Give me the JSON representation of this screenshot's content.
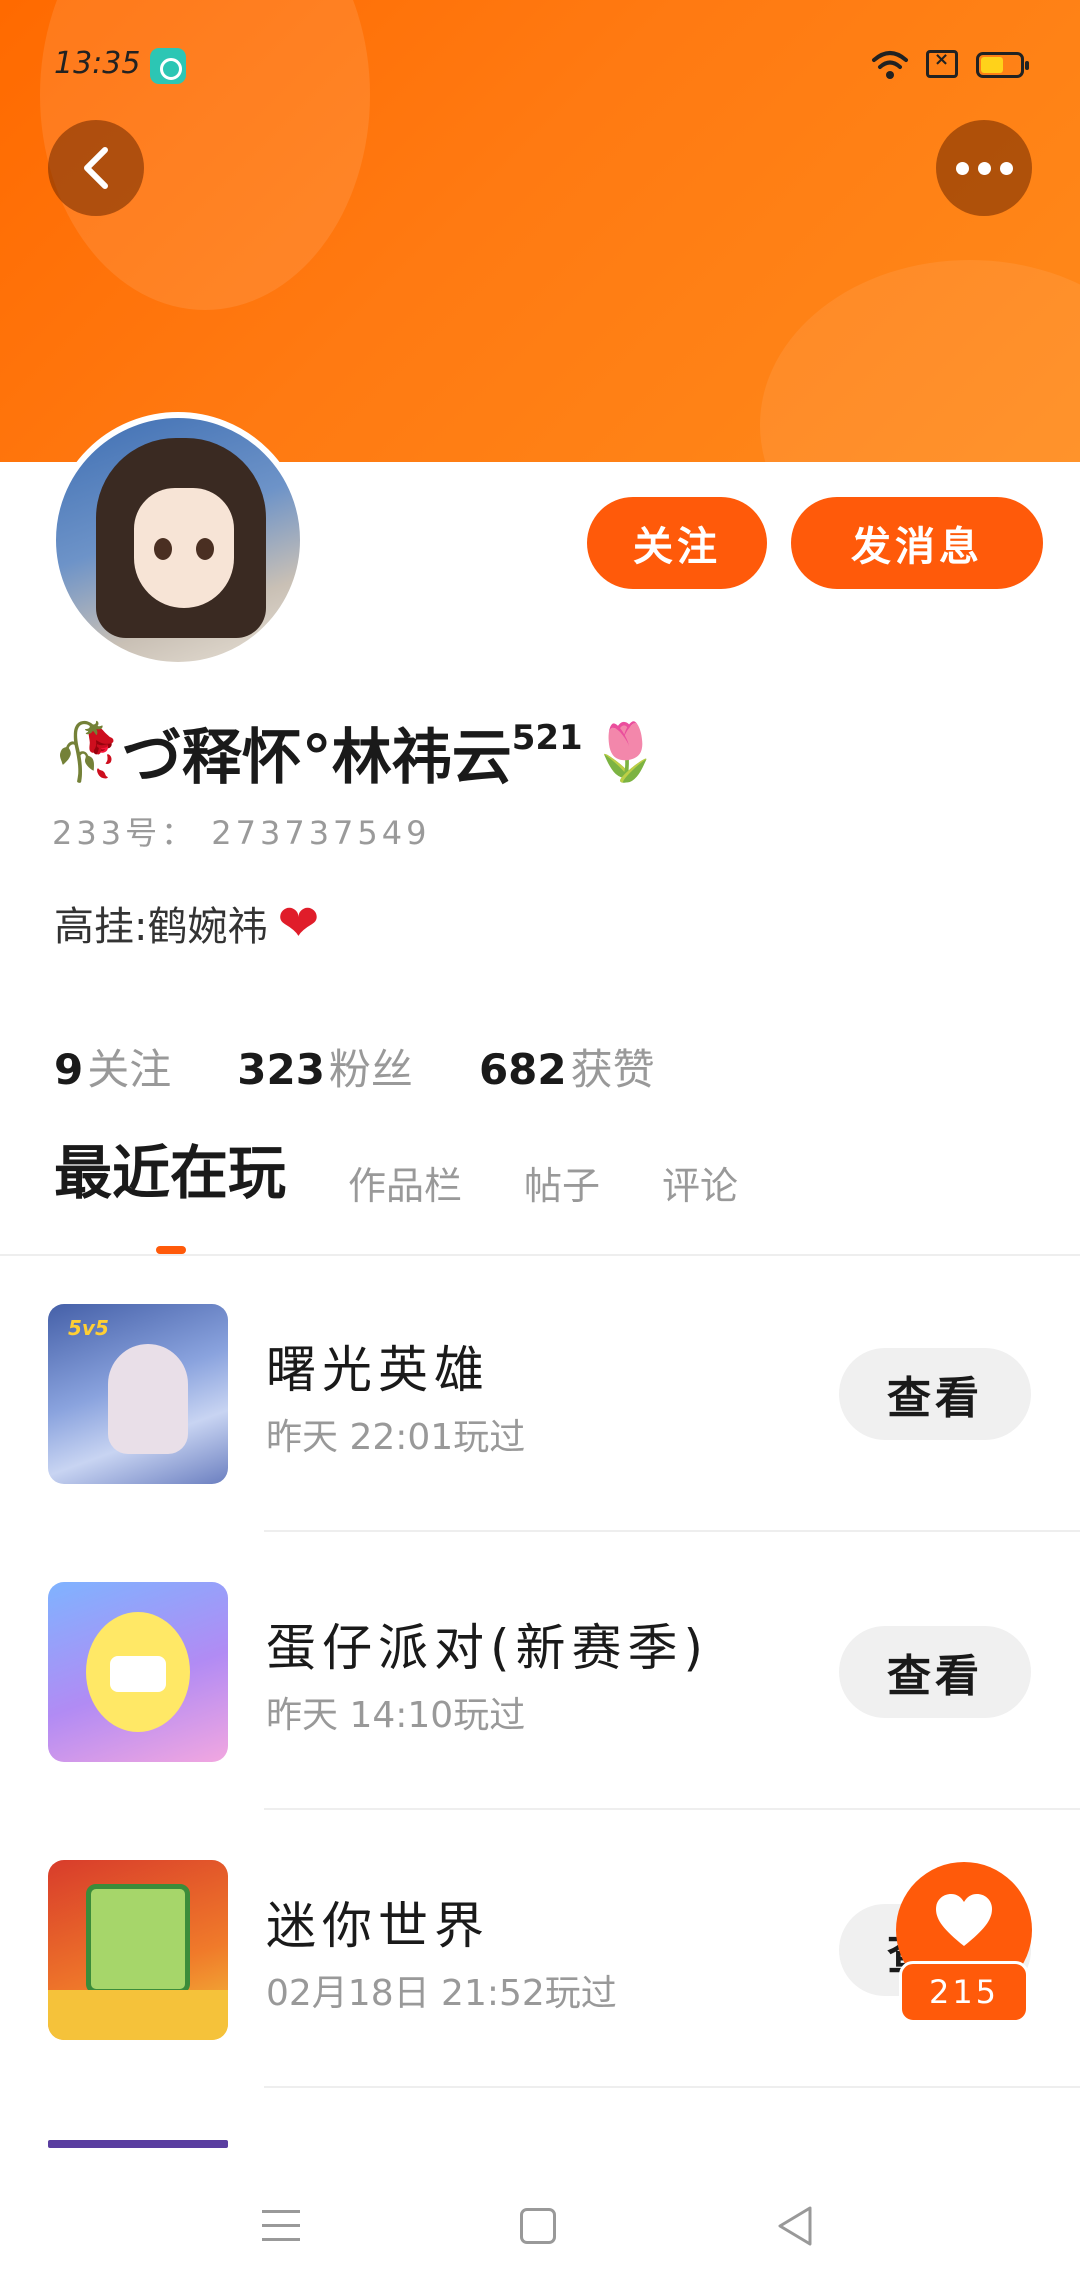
{
  "status_bar": {
    "time": "13:35",
    "sim_icon": "sim-x-icon",
    "battery_color": "#ffd21a"
  },
  "header": {
    "back_icon": "chevron-left-icon",
    "more_icon": "more-dots-icon",
    "banner_color": "#ff6a00"
  },
  "profile": {
    "follow_label": "关注",
    "message_label": "发消息",
    "name_prefix_emoji": "🥀",
    "name": "づ释怀°林祎云",
    "name_suffix": "521",
    "name_suffix_emoji": "🌷",
    "id_text": "233号： 273737549",
    "bio_text": "高挂:鹤婉祎",
    "bio_emoji": "❤",
    "accent_color": "#ff5a0a"
  },
  "stats": [
    {
      "value": "9",
      "label": "关注"
    },
    {
      "value": "323",
      "label": "粉丝"
    },
    {
      "value": "682",
      "label": "获赞"
    }
  ],
  "tabs": [
    {
      "label": "最近在玩",
      "active": true
    },
    {
      "label": "作品栏",
      "active": false
    },
    {
      "label": "帖子",
      "active": false
    },
    {
      "label": "评论",
      "active": false
    }
  ],
  "games": [
    {
      "name": "曙光英雄",
      "time": "昨天 22:01玩过",
      "button": "查看",
      "icon_tag": "5v5"
    },
    {
      "name": "蛋仔派对(新赛季)",
      "time": "昨天 14:10玩过",
      "button": "查看"
    },
    {
      "name": "迷你世界",
      "time": "02月18日 21:52玩过",
      "button": "查看"
    }
  ],
  "fab": {
    "icon": "heart-icon",
    "count": "215"
  }
}
